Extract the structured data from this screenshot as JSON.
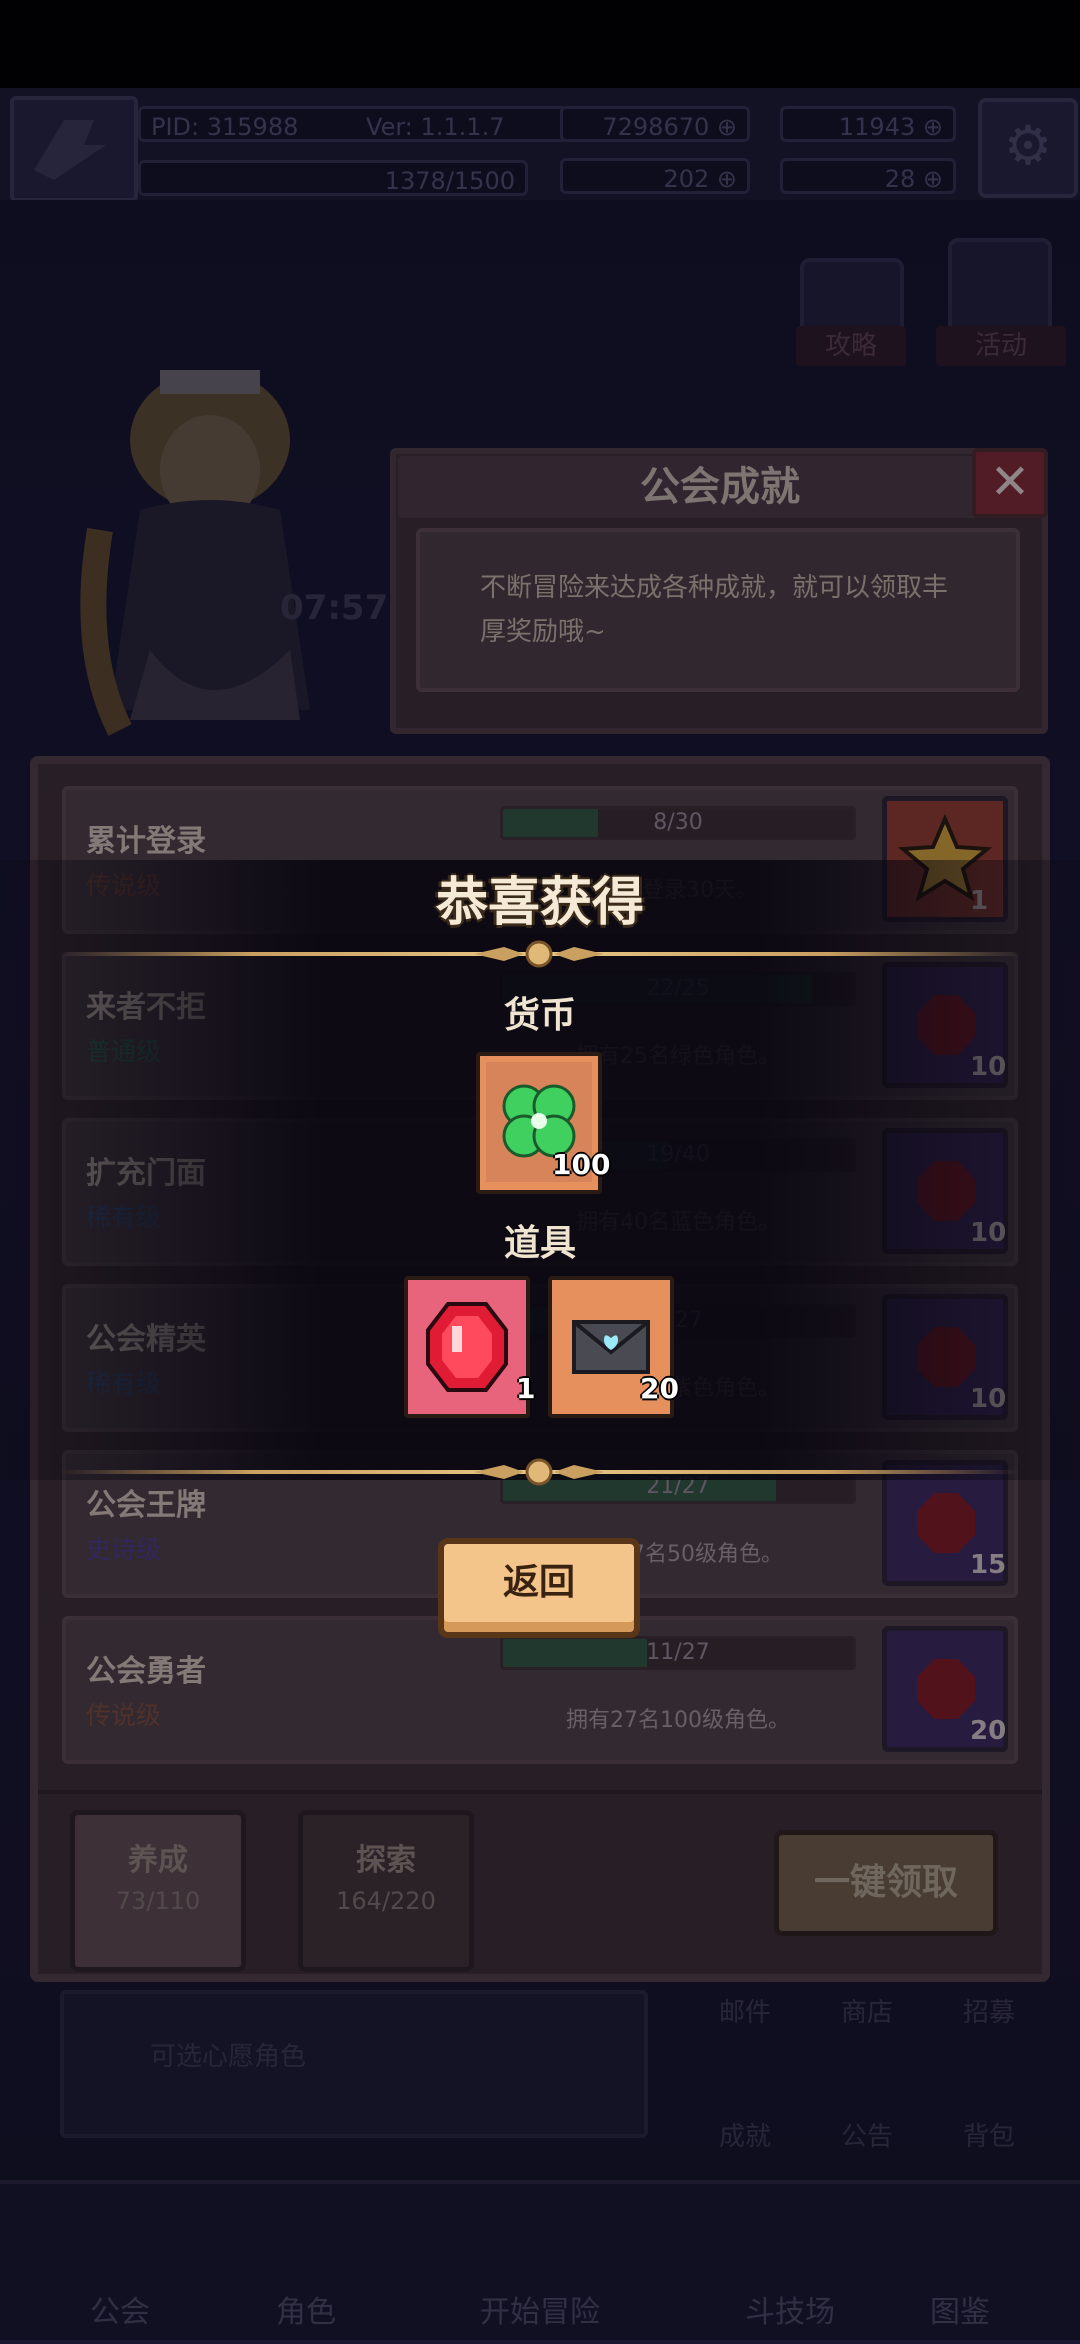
{
  "top_bar": {
    "pid": "PID: 315988",
    "version": "Ver: 1.1.1.7",
    "gold": "7298670",
    "gems": "11943",
    "exp": "1378/1500",
    "clover": "202",
    "keys": "28"
  },
  "side": {
    "strategy_label": "攻略",
    "event_label": "活动",
    "timer": "07:57"
  },
  "achievement": {
    "title": "公会成就",
    "description": "不断冒险来达成各种成就，就可以领取丰厚奖励哦~",
    "rows": [
      {
        "name": "累计登录",
        "rank": "传说级",
        "rank_color": "#7a4a3a",
        "progress": "8/30",
        "progress_value": 0.27,
        "desc": "累计登录30天。",
        "reward_count": "1",
        "reward_bg": "#8a3a30"
      },
      {
        "name": "来者不拒",
        "rank": "普通级",
        "rank_color": "#2f6a58",
        "progress": "22/25",
        "progress_value": 0.88,
        "desc": "拥有25名绿色角色。",
        "reward_count": "10",
        "reward_bg": "#3a2a5c"
      },
      {
        "name": "扩充门面",
        "rank": "稀有级",
        "rank_color": "#36507a",
        "progress": "19/40",
        "progress_value": 0.47,
        "desc": "拥有40名蓝色角色。",
        "reward_count": "10",
        "reward_bg": "#3a2a5c"
      },
      {
        "name": "公会精英",
        "rank": "稀有级",
        "rank_color": "#36507a",
        "progress": "8/27",
        "progress_value": 0.3,
        "desc": "拥有27名紫色角色。",
        "reward_count": "10",
        "reward_bg": "#3a2a5c"
      },
      {
        "name": "公会王牌",
        "rank": "史诗级",
        "rank_color": "#4a3a8a",
        "progress": "21/27",
        "progress_value": 0.78,
        "desc": "拥有27名50级角色。",
        "reward_count": "15",
        "reward_bg": "#3a2a5c"
      },
      {
        "name": "公会勇者",
        "rank": "传说级",
        "rank_color": "#7a4a3a",
        "progress": "11/27",
        "progress_value": 0.41,
        "desc": "拥有27名100级角色。",
        "reward_count": "20",
        "reward_bg": "#3a2a5c"
      }
    ],
    "tabs": [
      {
        "label": "养成",
        "count": "73/110"
      },
      {
        "label": "探索",
        "count": "164/220"
      }
    ],
    "claim_all": "一键领取"
  },
  "popup": {
    "title": "恭喜获得",
    "currency_title": "货币",
    "items_title": "道具",
    "currency": [
      {
        "icon": "clover-icon",
        "count": "100"
      }
    ],
    "items": [
      {
        "icon": "ruby-icon",
        "count": "1"
      },
      {
        "icon": "letter-icon",
        "count": "20"
      }
    ],
    "back": "返回"
  },
  "background": {
    "recruit_sub": "可选心愿角色",
    "menu": [
      "邮件",
      "商店",
      "招募",
      "成就",
      "公告",
      "背包"
    ]
  },
  "nav": [
    "公会",
    "角色",
    "开始冒险",
    "斗技场",
    "图鉴"
  ]
}
